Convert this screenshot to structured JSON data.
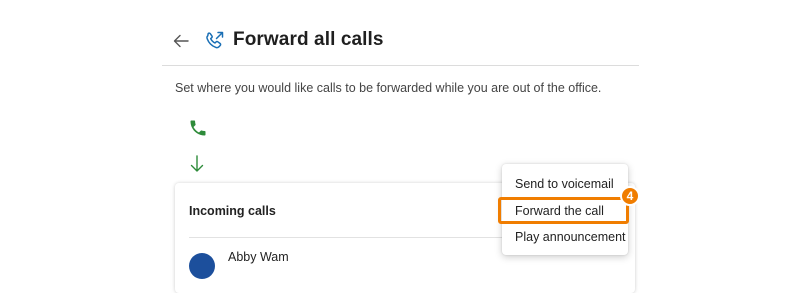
{
  "header": {
    "title": "Forward all calls",
    "back_icon": "arrow-left-icon",
    "title_icon": "phone-forward-icon"
  },
  "description": "Set where you would like calls to be forwarded while you are out of the office.",
  "flow": {
    "phone_icon": "phone-icon",
    "arrow_icon": "arrow-down-icon"
  },
  "card": {
    "heading": "Incoming calls",
    "contact_name": "Abby Wam"
  },
  "menu": {
    "items": [
      {
        "label": "Send to voicemail"
      },
      {
        "label": "Forward the call"
      },
      {
        "label": "Play announcement"
      }
    ],
    "highlighted_index": 1
  },
  "annotation": {
    "step": "4"
  },
  "colors": {
    "accent_blue": "#1a6fb5",
    "phone_green": "#2e8b3a",
    "highlight_orange": "#f07d00",
    "avatar_blue": "#1c4f9c"
  }
}
